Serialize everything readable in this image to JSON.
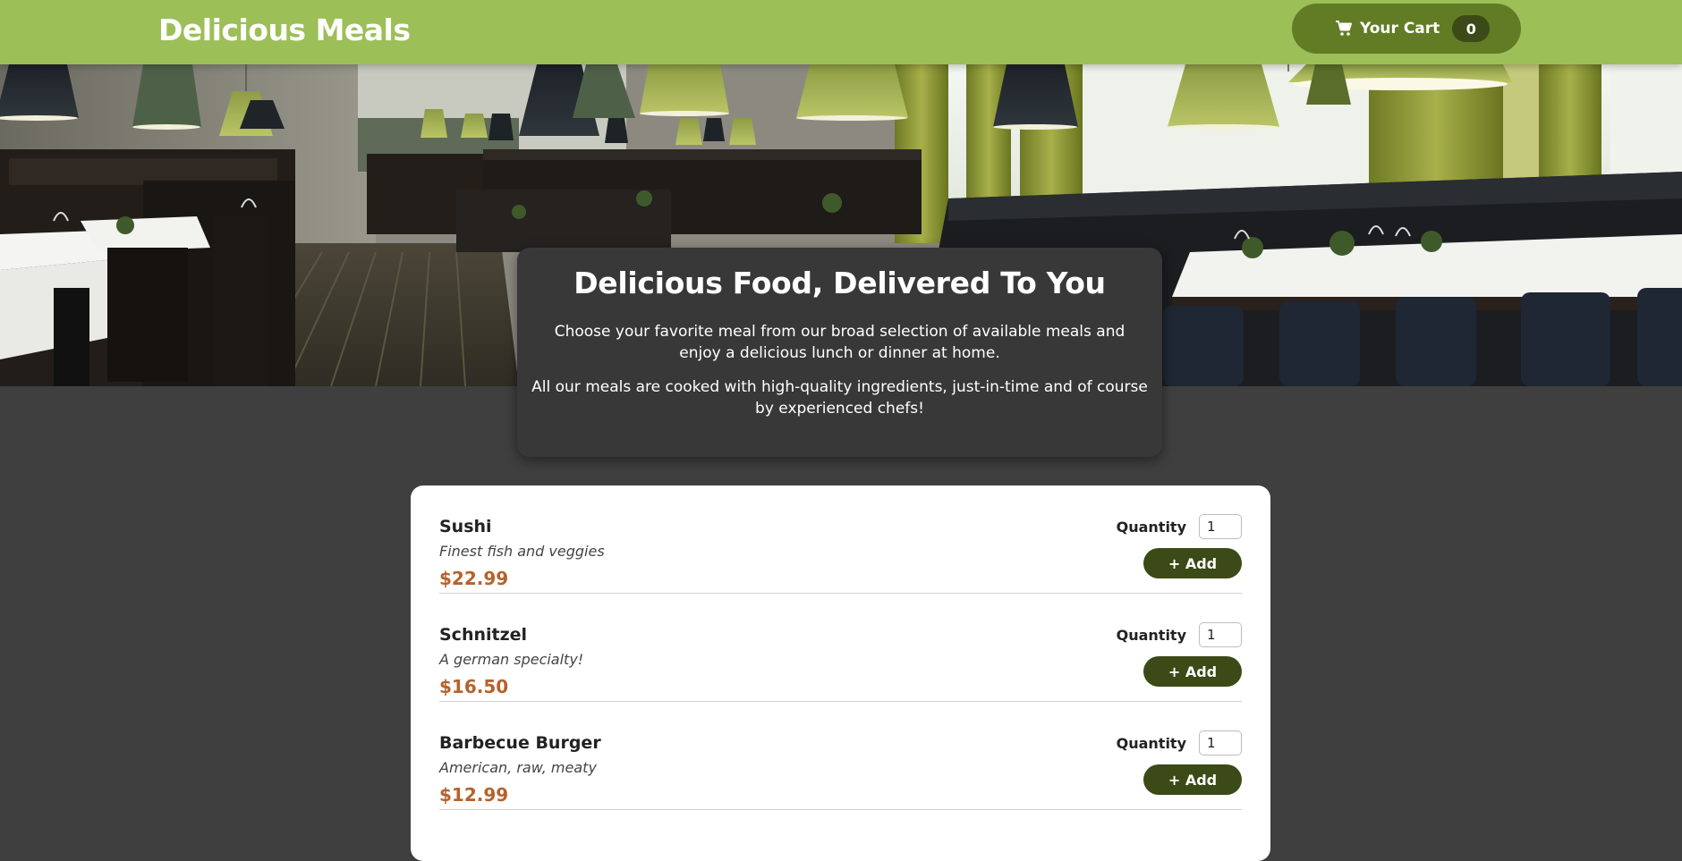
{
  "header": {
    "brand": "Delicious Meals",
    "cart": {
      "label": "Your Cart",
      "count": "0",
      "icon": "cart-icon"
    }
  },
  "hero": {
    "image": "restaurant-interior-image"
  },
  "summary": {
    "title": "Delicious Food, Delivered To You",
    "paragraph1": "Choose your favorite meal from our broad selection of available meals and enjoy a delicious lunch or dinner at home.",
    "paragraph2": "All our meals are cooked with high-quality ingredients, just-in-time and of course by experienced chefs!"
  },
  "meals": [
    {
      "name": "Sushi",
      "description": "Finest fish and veggies",
      "price": "$22.99",
      "quantity_label": "Quantity",
      "quantity_value": "1",
      "add_label": "+ Add"
    },
    {
      "name": "Schnitzel",
      "description": "A german specialty!",
      "price": "$16.50",
      "quantity_label": "Quantity",
      "quantity_value": "1",
      "add_label": "+ Add"
    },
    {
      "name": "Barbecue Burger",
      "description": "American, raw, meaty",
      "price": "$12.99",
      "quantity_label": "Quantity",
      "quantity_value": "1",
      "add_label": "+ Add"
    }
  ],
  "colors": {
    "header": "#9cbf58",
    "cart_button": "#627c25",
    "add_button": "#3b4a16",
    "price": "#b6622b",
    "background": "#3f3f3f"
  }
}
